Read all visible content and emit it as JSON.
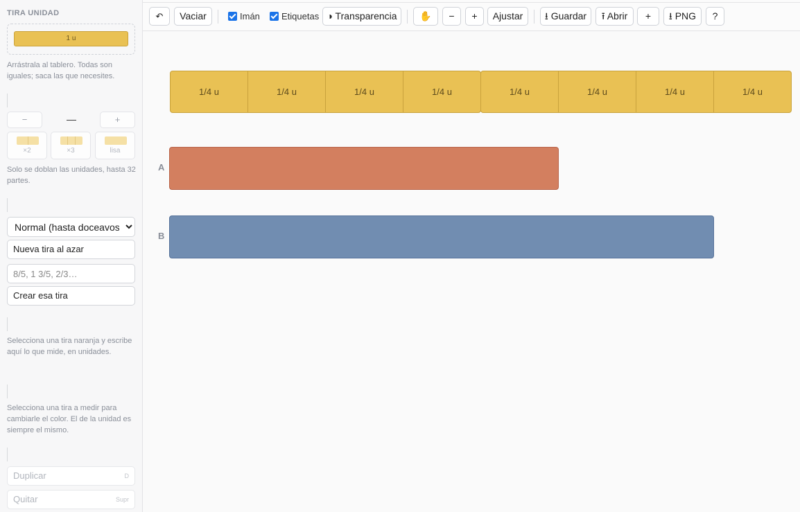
{
  "sidebar": {
    "title": "TIRA UNIDAD",
    "unit_strip_label": "1 u",
    "unit_note": "Arrástrala al tablero. Todas son iguales; saca las que necesites.",
    "minus_label": "−",
    "count_label": "—",
    "plus_label": "+",
    "fold_x2": "×2",
    "fold_x3": "×3",
    "fold_plain": "lisa",
    "fold_note": "Solo se doblan las unidades, hasta 32 partes.",
    "level_select": "Normal (hasta doceavos)",
    "random_button": "Nueva tira al azar",
    "fraction_placeholder": "8/5, 1 3/5, 2/3…",
    "create_button": "Crear esa tira",
    "measure_note": "Selecciona una tira naranja y escribe aquí lo que mide, en unidades.",
    "color_note": "Selecciona una tira a medir para cambiarle el color. El de la unidad es siempre el mismo.",
    "duplicate_label": "Duplicar",
    "duplicate_key": "D",
    "remove_label": "Quitar",
    "remove_key": "Supr"
  },
  "toolbar": {
    "undo": "↶",
    "clear": "Vaciar",
    "magnet": "Imán",
    "labels": "Etiquetas",
    "transparency": "◑ Transparencia",
    "hand": "✋",
    "zoom_out": "−",
    "zoom_in": "+",
    "fit": "Ajustar",
    "save": "⭳ Guardar",
    "open": "⭱ Abrir",
    "new": "+",
    "png": "⭳ PNG",
    "help": "?"
  },
  "board": {
    "pieces": [
      "1/4 u",
      "1/4 u",
      "1/4 u",
      "1/4 u",
      "1/4 u",
      "1/4 u",
      "1/4 u",
      "1/4 u"
    ],
    "strip_a": {
      "label": "A",
      "color": "#d37f5f"
    },
    "strip_b": {
      "label": "B",
      "color": "#718db1"
    }
  }
}
